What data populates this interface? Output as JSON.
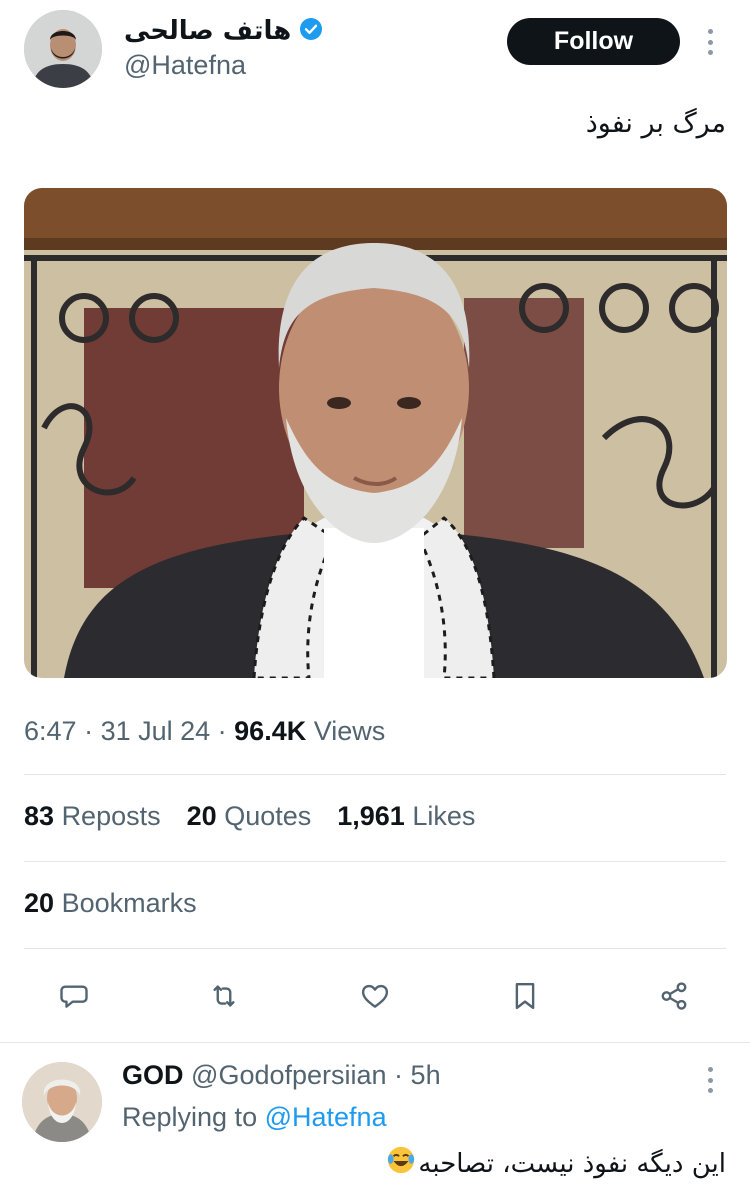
{
  "tweet": {
    "author": {
      "display_name": "هاتف صالحی",
      "handle": "@Hatefna",
      "verified": true
    },
    "follow_label": "Follow",
    "text": "مرگ بر نفوذ",
    "time": "6:47",
    "date": "31 Jul 24",
    "views_count": "96.4K",
    "views_label": "Views",
    "stats": {
      "reposts_count": "83",
      "reposts_label": "Reposts",
      "quotes_count": "20",
      "quotes_label": "Quotes",
      "likes_count": "1,961",
      "likes_label": "Likes",
      "bookmarks_count": "20",
      "bookmarks_label": "Bookmarks"
    },
    "actions": [
      "reply-icon",
      "repost-icon",
      "like-icon",
      "bookmark-icon",
      "share-icon"
    ]
  },
  "reply": {
    "display_name": "GOD",
    "handle": "@Godofpersiian",
    "age": "5h",
    "replying_label": "Replying to",
    "replying_to": "@Hatefna",
    "text": "این دیگه نفوذ نیست، تصاحبه",
    "emoji": "face-with-tears-of-joy"
  },
  "colors": {
    "text": "#0f1419",
    "secondary": "#536471",
    "accent": "#1d9bf0",
    "divider": "#e1e5e8"
  }
}
